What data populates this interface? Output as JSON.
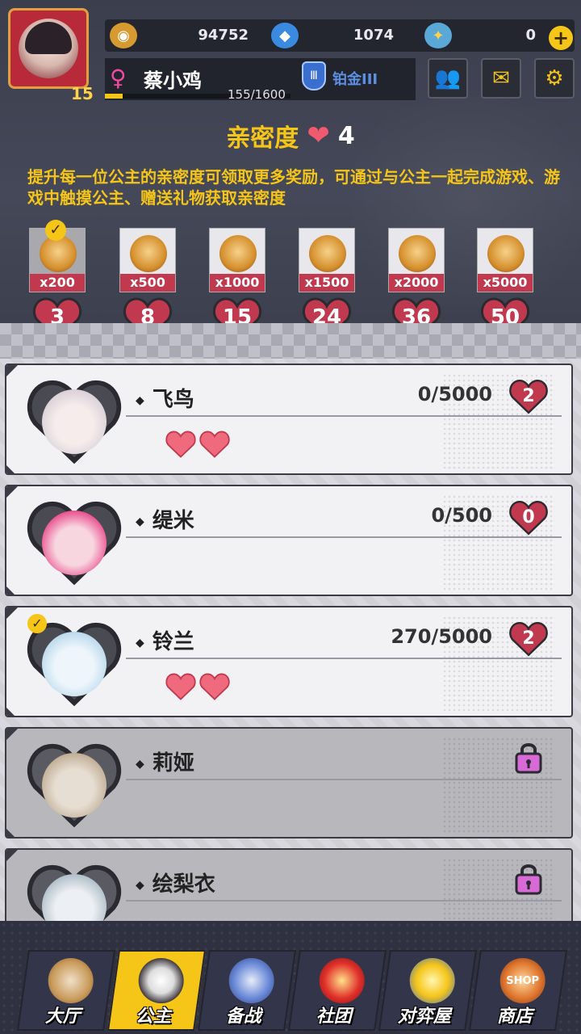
{
  "player": {
    "level": "15",
    "name": "蔡小鸡",
    "gender_icon": "female-symbol-icon",
    "rank": "铂金III",
    "exp_text": "155/1600",
    "exp_fraction": 0.097
  },
  "resources": {
    "coins": "94752",
    "diamonds": "1074",
    "tickets": "0"
  },
  "intimacy": {
    "title": "亲密度",
    "hearts": "4",
    "description": "提升每一位公主的亲密度可领取更多奖励，可通过与公主一起完成游戏、游戏中触摸公主、赠送礼物获取亲密度",
    "rewards": [
      {
        "amount": "x200",
        "goal": "3",
        "claimed": true
      },
      {
        "amount": "x500",
        "goal": "8",
        "claimed": false
      },
      {
        "amount": "x1000",
        "goal": "15",
        "claimed": false
      },
      {
        "amount": "x1500",
        "goal": "24",
        "claimed": false
      },
      {
        "amount": "x2000",
        "goal": "36",
        "claimed": false
      },
      {
        "amount": "x5000",
        "goal": "50",
        "claimed": false
      }
    ]
  },
  "princesses": [
    {
      "name": "飞鸟",
      "progress": "0/5000",
      "level": "2",
      "hearts": 2,
      "locked": false,
      "selected": false
    },
    {
      "name": "缇米",
      "progress": "0/500",
      "level": "0",
      "hearts": 0,
      "locked": false,
      "selected": false
    },
    {
      "name": "铃兰",
      "progress": "270/5000",
      "level": "2",
      "hearts": 2,
      "locked": false,
      "selected": true
    },
    {
      "name": "莉娅",
      "progress": "",
      "level": "",
      "hearts": 0,
      "locked": true,
      "selected": false
    },
    {
      "name": "绘梨衣",
      "progress": "",
      "level": "",
      "hearts": 0,
      "locked": true,
      "selected": false
    }
  ],
  "nav": {
    "hall": "大厅",
    "princess": "公主",
    "prepare": "备战",
    "club": "社团",
    "arena": "对弈屋",
    "shop": "商店",
    "shop_sign": "SHOP"
  },
  "colors": {
    "accent": "#f5c518",
    "heart": "#ef5a6f",
    "badge": "#c0394e",
    "rank_blue": "#5c8fe0"
  }
}
